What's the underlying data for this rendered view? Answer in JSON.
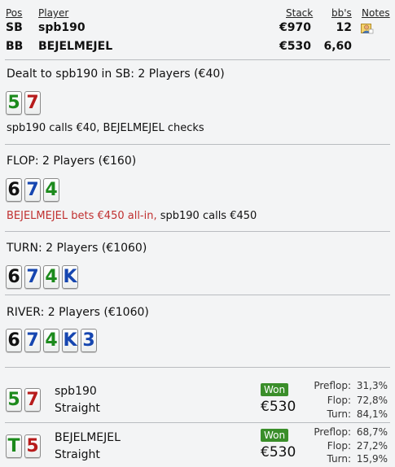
{
  "header": {
    "col_pos": "Pos",
    "col_player": "Player",
    "col_stack": "Stack",
    "col_bbs": "bb's",
    "col_notes": "Notes",
    "players": [
      {
        "pos": "SB",
        "name": "spb190",
        "stack": "€970",
        "bbs": "12",
        "has_note": true
      },
      {
        "pos": "BB",
        "name": "BEJELMEJEL",
        "stack": "€530",
        "bbs": "6,60",
        "has_note": false
      }
    ]
  },
  "preflop": {
    "title": "Dealt to spb190 in SB: 2 Players (€40)",
    "cards": [
      {
        "rank": "5",
        "suit": "c"
      },
      {
        "rank": "7",
        "suit": "h"
      }
    ],
    "action": "spb190 calls €40, BEJELMEJEL checks"
  },
  "flop": {
    "title": "FLOP: 2 Players (€160)",
    "cards": [
      {
        "rank": "6",
        "suit": "s"
      },
      {
        "rank": "7",
        "suit": "d"
      },
      {
        "rank": "4",
        "suit": "c"
      }
    ],
    "action_allin": "BEJELMEJEL bets €450 all-in,",
    "action_rest": " spb190 calls €450"
  },
  "turn": {
    "title": "TURN: 2 Players (€1060)",
    "cards": [
      {
        "rank": "6",
        "suit": "s"
      },
      {
        "rank": "7",
        "suit": "d"
      },
      {
        "rank": "4",
        "suit": "c"
      },
      {
        "rank": "K",
        "suit": "d"
      }
    ]
  },
  "river": {
    "title": "RIVER: 2 Players (€1060)",
    "cards": [
      {
        "rank": "6",
        "suit": "s"
      },
      {
        "rank": "7",
        "suit": "d"
      },
      {
        "rank": "4",
        "suit": "c"
      },
      {
        "rank": "K",
        "suit": "d"
      },
      {
        "rank": "3",
        "suit": "d"
      }
    ]
  },
  "showdown": [
    {
      "cards": [
        {
          "rank": "5",
          "suit": "c"
        },
        {
          "rank": "7",
          "suit": "h"
        }
      ],
      "name": "spb190",
      "hand": "Straight",
      "badge": "Won",
      "amount": "€530",
      "equity": [
        {
          "label": "Preflop:",
          "value": "31,3%"
        },
        {
          "label": "Flop:",
          "value": "72,8%"
        },
        {
          "label": "Turn:",
          "value": "84,1%"
        }
      ]
    },
    {
      "cards": [
        {
          "rank": "T",
          "suit": "c"
        },
        {
          "rank": "5",
          "suit": "h"
        }
      ],
      "name": "BEJELMEJEL",
      "hand": "Straight",
      "badge": "Won",
      "amount": "€530",
      "equity": [
        {
          "label": "Preflop:",
          "value": "68,7%"
        },
        {
          "label": "Flop:",
          "value": "27,2%"
        },
        {
          "label": "Turn:",
          "value": "15,9%"
        }
      ]
    }
  ],
  "colors": {
    "club": "#1c8a1c",
    "heart": "#b71c1c",
    "spade": "#111111",
    "diamond": "#1646b0",
    "allin_text": "#c03030",
    "won_badge": "#3a8e2a"
  }
}
